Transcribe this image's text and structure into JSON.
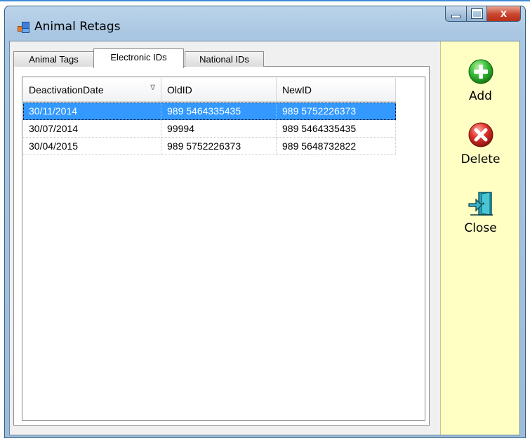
{
  "window": {
    "title": "Animal Retags",
    "caption_close": "x"
  },
  "tabs": [
    {
      "label": "Animal Tags",
      "active": false
    },
    {
      "label": "Electronic IDs",
      "active": true
    },
    {
      "label": "National IDs",
      "active": false
    }
  ],
  "grid": {
    "columns": [
      "DeactivationDate",
      "OldID",
      "NewID"
    ],
    "sort_glyph": "∇",
    "rows": [
      {
        "deactivation_date": "30/11/2014",
        "old_id": "989 5464335435",
        "new_id": "989 5752226373",
        "selected": true
      },
      {
        "deactivation_date": "30/07/2014",
        "old_id": "99994",
        "new_id": "989 5464335435",
        "selected": false
      },
      {
        "deactivation_date": "30/04/2015",
        "old_id": "989 5752226373",
        "new_id": "989 5648732822",
        "selected": false
      }
    ]
  },
  "toolbar": {
    "add_label": "Add",
    "delete_label": "Delete",
    "close_label": "Close",
    "add_icon": "plus-circle-icon",
    "delete_icon": "x-circle-icon",
    "close_icon": "exit-door-icon"
  },
  "colors": {
    "selection": "#3399ff",
    "toolpanel_bg": "#ffffc4",
    "add_green": "#22aa22",
    "delete_red": "#d62b22",
    "door_teal": "#2aa6b8"
  }
}
